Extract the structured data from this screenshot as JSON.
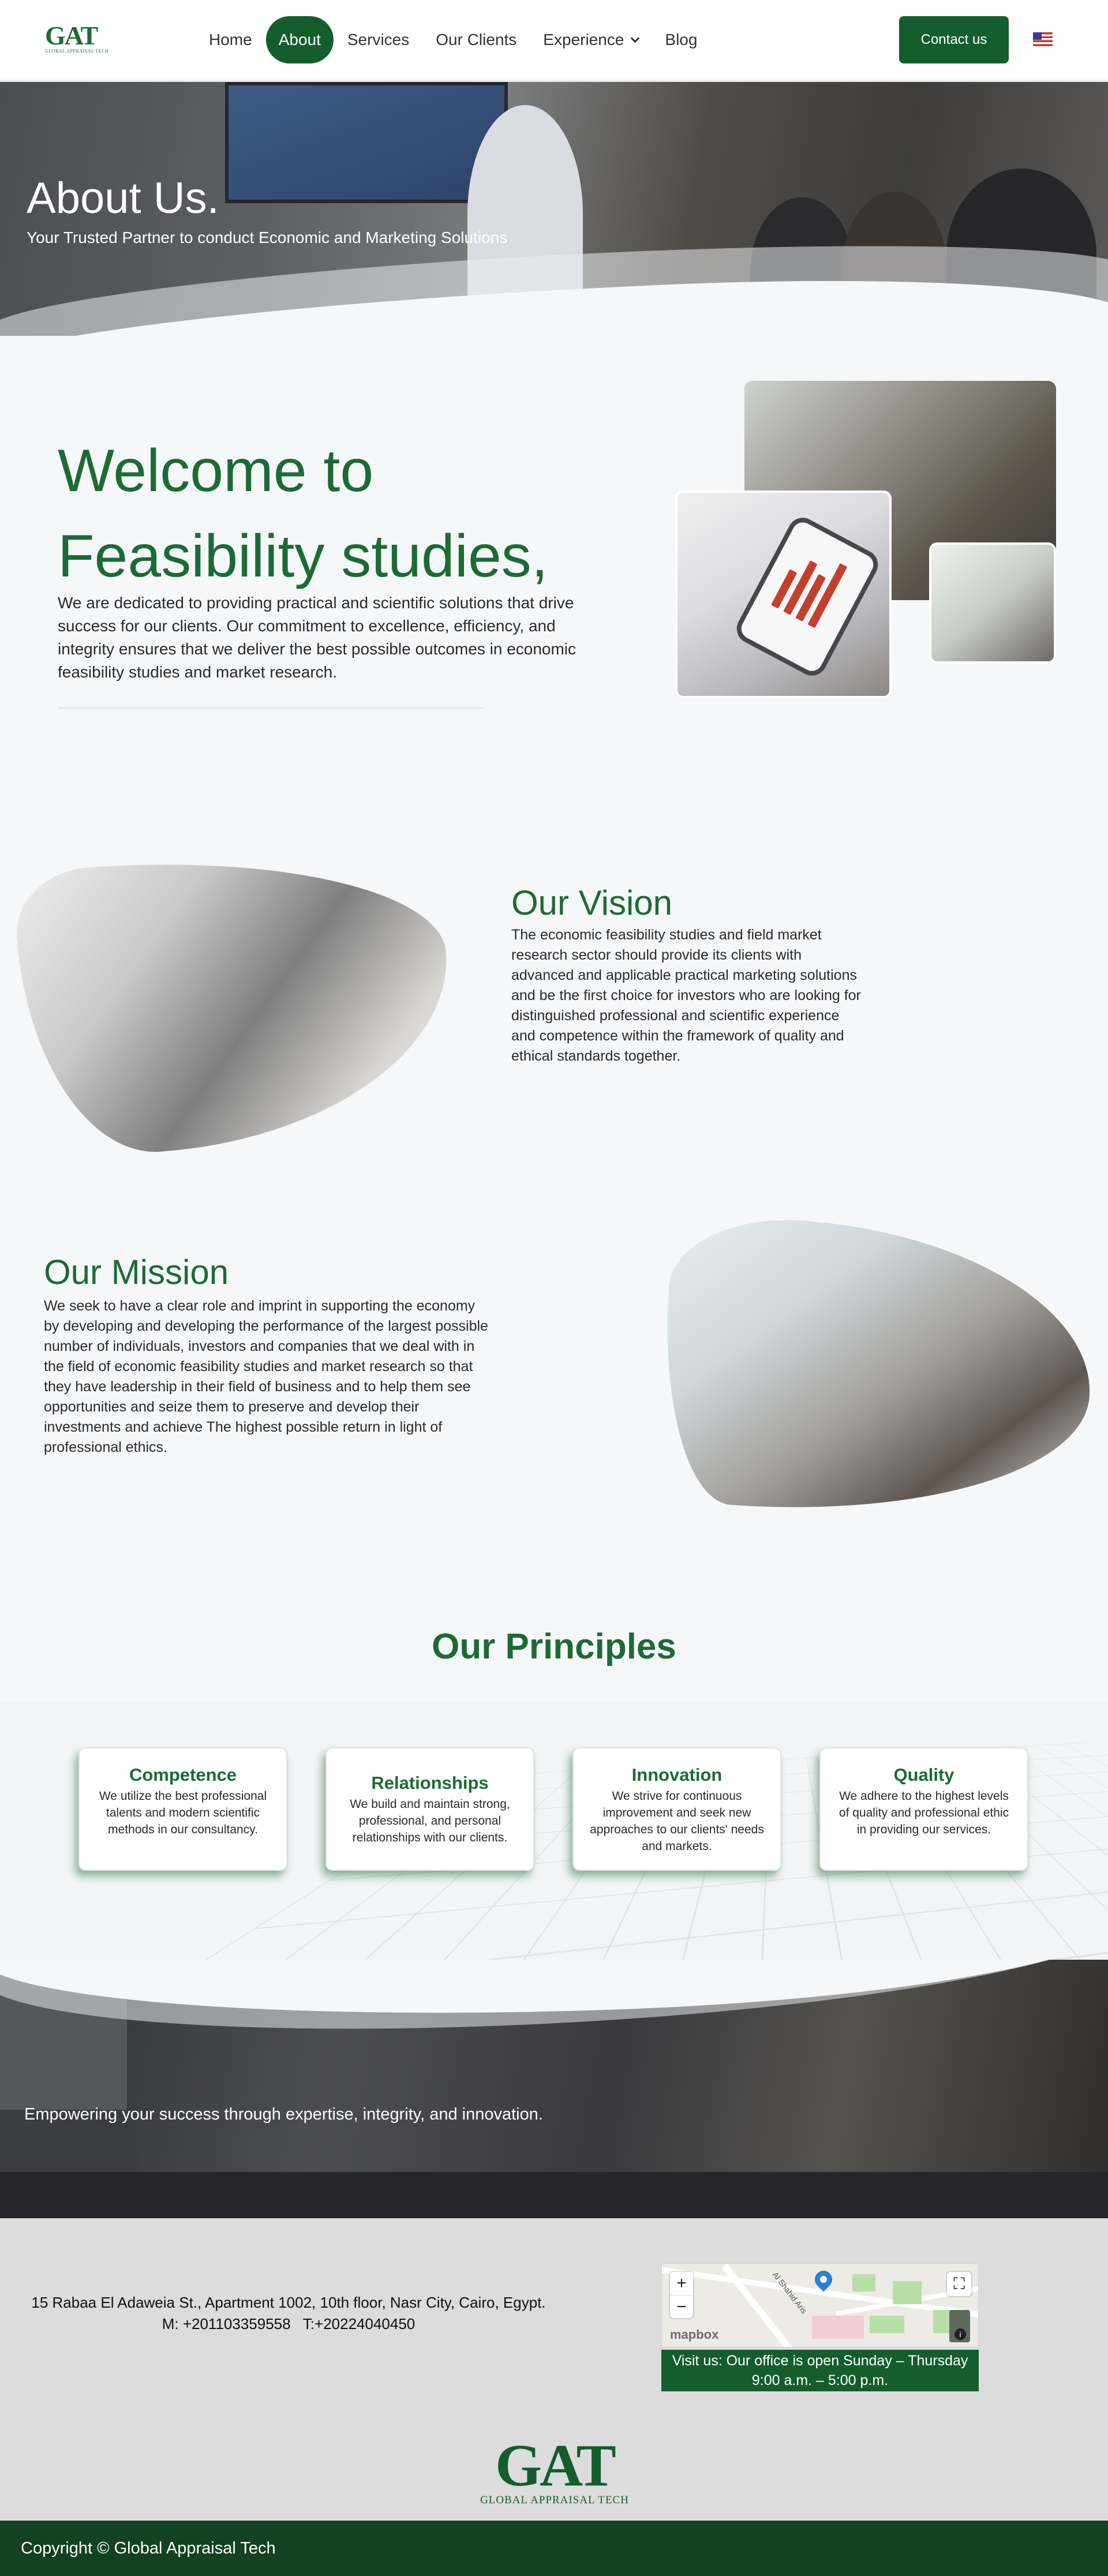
{
  "header": {
    "logo_mark": "GAT",
    "logo_sub": "GLOBAL APPRAISAL TECH",
    "nav": [
      "Home",
      "About",
      "Services",
      "Our Clients",
      "Experience",
      "Blog"
    ],
    "active_nav": "About",
    "contact_label": "Contact us",
    "language_flag": "us-flag-icon"
  },
  "hero": {
    "title": "About Us.",
    "subtitle": "Your Trusted Partner to conduct Economic and Marketing Solutions"
  },
  "welcome": {
    "title_line1": "Welcome to",
    "title_line2": "Feasibility studies,",
    "text": "We are dedicated to providing practical and scientific solutions that drive success for our clients. Our commitment to excellence, efficiency, and integrity ensures that we deliver the best possible outcomes in economic feasibility studies and market research."
  },
  "vision": {
    "title": "Our Vision",
    "text": "The economic feasibility studies and field market research sector should provide its clients with advanced and applicable practical marketing solutions and be the first choice for investors who are looking for distinguished professional and scientific experience and competence within the framework of quality and ethical standards together."
  },
  "mission": {
    "title": "Our Mission",
    "text": "We seek to have a clear role and imprint in supporting the economy by developing and developing the performance of the largest possible number of individuals, investors and companies that we deal with in the field of economic feasibility studies and market research so that they have leadership in their field of business and to help them see opportunities and seize them to preserve and develop their investments and achieve The highest possible return in light of professional ethics."
  },
  "principles": {
    "title": "Our Principles",
    "cards": [
      {
        "title": "Competence",
        "text": "We utilize the best professional talents and modern scientific methods in our consultancy."
      },
      {
        "title": "Relationships",
        "text": "We build and maintain strong, professional, and personal relationships with our clients."
      },
      {
        "title": "Innovation",
        "text": "We strive for continuous improvement and seek new approaches to our clients' needs and markets."
      },
      {
        "title": "Quality",
        "text": "We adhere to the highest levels of quality and professional ethic in providing our services."
      }
    ]
  },
  "banner": {
    "text": "Empowering your success through expertise, integrity, and innovation."
  },
  "footer": {
    "address": "15 Rabaa El Adaweia St., Apartment 1002, 10th floor, Nasr City, Cairo, Egypt.",
    "phones": "M: +201103359558   T:+20224040450",
    "map_street": "Al Shahid Aris",
    "map_brand": "mapbox",
    "map_info": "i",
    "zoom_in": "+",
    "zoom_out": "−",
    "fullscreen_icon": "⛶",
    "office_hours_line1": "Visit us: Our office is open Sunday – Thursday",
    "office_hours_line2": "9:00 a.m. – 5:00 p.m.",
    "logo_mark": "GAT",
    "logo_sub": "GLOBAL APPRAISAL TECH",
    "copyright": "Copyright © Global Appraisal Tech"
  },
  "colors": {
    "brand_green": "#1b6b35",
    "button_green": "#145d2c",
    "copyright_bar": "#12421f"
  }
}
